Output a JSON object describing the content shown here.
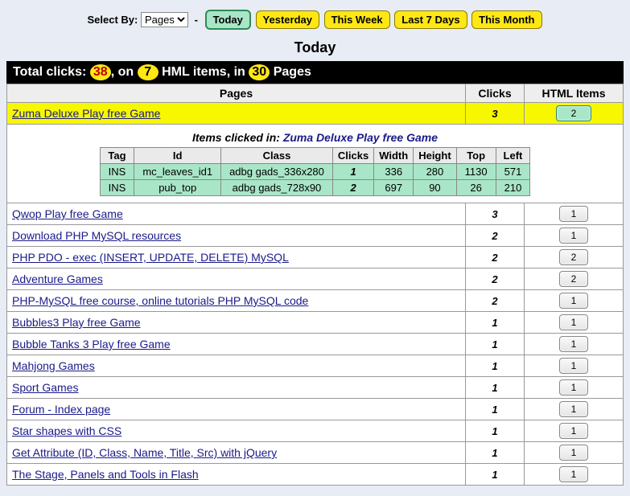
{
  "controls": {
    "select_by_label": "Select By:",
    "select_value": "Pages",
    "dash": "-",
    "buttons": [
      "Today",
      "Yesterday",
      "This Week",
      "Last 7 Days",
      "This Month"
    ],
    "active_index": 0
  },
  "title": "Today",
  "summary": {
    "prefix": "Total clicks:",
    "clicks": "38",
    "mid1": ", on",
    "items": "7",
    "mid2": "HML items, in",
    "pages": "30",
    "suffix": "Pages"
  },
  "headers": {
    "pages": "Pages",
    "clicks": "Clicks",
    "html_items": "HTML Items"
  },
  "detail": {
    "caption_prefix": "Items clicked in:",
    "page_name": "Zuma Deluxe Play free Game",
    "cols": [
      "Tag",
      "Id",
      "Class",
      "Clicks",
      "Width",
      "Height",
      "Top",
      "Left"
    ],
    "rows": [
      {
        "tag": "INS",
        "id": "mc_leaves_id1",
        "class": "adbg gads_336x280",
        "clicks": "1",
        "width": "336",
        "height": "280",
        "top": "1130",
        "left": "571"
      },
      {
        "tag": "INS",
        "id": "pub_top",
        "class": "adbg gads_728x90",
        "clicks": "2",
        "width": "697",
        "height": "90",
        "top": "26",
        "left": "210"
      }
    ]
  },
  "rows": [
    {
      "page": "Zuma Deluxe Play free Game",
      "clicks": "3",
      "items": "2",
      "hl": true,
      "green": true,
      "detail": true
    },
    {
      "page": "Qwop Play free Game",
      "clicks": "3",
      "items": "1"
    },
    {
      "page": "Download PHP MySQL resources",
      "clicks": "2",
      "items": "1"
    },
    {
      "page": "PHP PDO - exec (INSERT, UPDATE, DELETE) MySQL",
      "clicks": "2",
      "items": "2"
    },
    {
      "page": "Adventure Games",
      "clicks": "2",
      "items": "2"
    },
    {
      "page": "PHP-MySQL free course, online tutorials PHP MySQL code",
      "clicks": "2",
      "items": "1"
    },
    {
      "page": "Bubbles3 Play free Game",
      "clicks": "1",
      "items": "1"
    },
    {
      "page": "Bubble Tanks 3 Play free Game",
      "clicks": "1",
      "items": "1"
    },
    {
      "page": "Mahjong Games",
      "clicks": "1",
      "items": "1"
    },
    {
      "page": "Sport Games",
      "clicks": "1",
      "items": "1"
    },
    {
      "page": "Forum - Index page",
      "clicks": "1",
      "items": "1"
    },
    {
      "page": "Star shapes with CSS",
      "clicks": "1",
      "items": "1"
    },
    {
      "page": "Get Attribute (ID, Class, Name, Title, Src) with jQuery",
      "clicks": "1",
      "items": "1"
    },
    {
      "page": "The Stage, Panels and Tools in Flash",
      "clicks": "1",
      "items": "1"
    }
  ]
}
